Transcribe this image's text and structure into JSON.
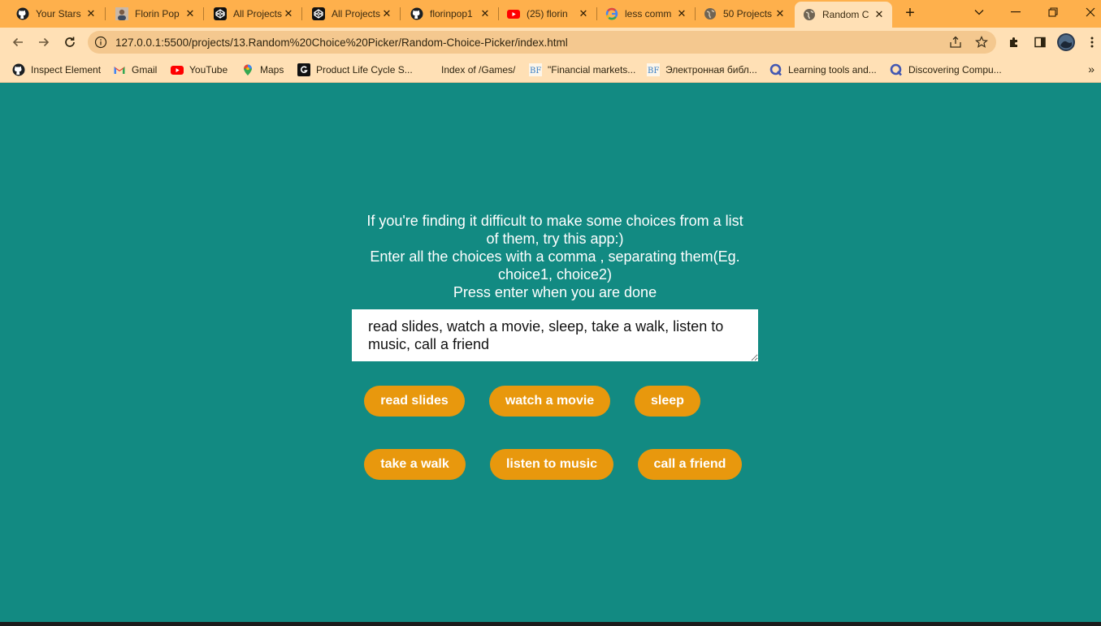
{
  "browser": {
    "tabs": [
      {
        "title": "Your Stars",
        "icon": "github-icon"
      },
      {
        "title": "Florin Pop",
        "icon": "avatar-icon"
      },
      {
        "title": "All Projects",
        "icon": "codepen-icon"
      },
      {
        "title": "All Projects",
        "icon": "codepen-icon"
      },
      {
        "title": "florinpop1",
        "icon": "github-icon"
      },
      {
        "title": "(25) florin",
        "icon": "youtube-icon"
      },
      {
        "title": "less comm",
        "icon": "google-icon"
      },
      {
        "title": "50 Projects",
        "icon": "globe-icon"
      },
      {
        "title": "Random C",
        "icon": "globe-icon",
        "active": true
      }
    ],
    "new_tab_label": "+",
    "url": "127.0.0.1:5500/projects/13.Random%20Choice%20Picker/Random-Choice-Picker/index.html",
    "bookmarks": [
      {
        "label": "Inspect Element",
        "icon": "github-icon"
      },
      {
        "label": "Gmail",
        "icon": "gmail-icon"
      },
      {
        "label": "YouTube",
        "icon": "youtube-icon"
      },
      {
        "label": "Maps",
        "icon": "maps-pin-icon"
      },
      {
        "label": "Product Life Cycle S...",
        "icon": "g-square-icon"
      },
      {
        "label": "Index of /Games/",
        "icon": ""
      },
      {
        "label": "\"Financial markets...",
        "icon": "bf-icon"
      },
      {
        "label": "Электронная библ...",
        "icon": "bf-icon"
      },
      {
        "label": "Learning tools and...",
        "icon": "q-icon"
      },
      {
        "label": "Discovering Compu...",
        "icon": "q-icon"
      }
    ],
    "bookmarks_more": "»",
    "colors": {
      "tabstrip": "#feb04c",
      "toolbar": "#ffe0b5",
      "omnibox": "#f4c88f"
    }
  },
  "app": {
    "intro_lines": [
      "If you're finding it difficult to make some choices from a list",
      "of them, try this app:)",
      "Enter all the choices with a comma , separating them(Eg.",
      "choice1, choice2)",
      "Press enter when you are done"
    ],
    "textarea_value": "read slides, watch a movie, sleep, take a walk, listen to music, call a friend",
    "tags": [
      "read slides",
      "watch a movie",
      "sleep",
      "take a walk",
      "listen to music",
      "call a friend"
    ],
    "colors": {
      "background": "#128a82",
      "tag": "#e8980d",
      "text": "#ffffff"
    }
  }
}
